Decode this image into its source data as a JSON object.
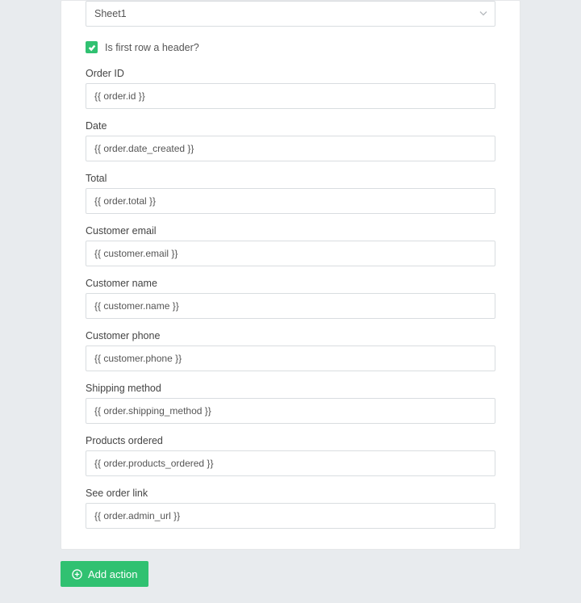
{
  "sheet": {
    "selected": "Sheet1"
  },
  "checkbox": {
    "label": "Is first row a header?",
    "checked": true
  },
  "fields": {
    "order_id": {
      "label": "Order ID",
      "value": "{{ order.id }}"
    },
    "date": {
      "label": "Date",
      "value": "{{ order.date_created }}"
    },
    "total": {
      "label": "Total",
      "value": "{{ order.total }}"
    },
    "customer_email": {
      "label": "Customer email",
      "value": "{{ customer.email }}"
    },
    "customer_name": {
      "label": "Customer name",
      "value": "{{ customer.name }}"
    },
    "customer_phone": {
      "label": "Customer phone",
      "value": "{{ customer.phone }}"
    },
    "shipping_method": {
      "label": "Shipping method",
      "value": "{{ order.shipping_method }}"
    },
    "products_ordered": {
      "label": "Products ordered",
      "value": "{{ order.products_ordered }}"
    },
    "see_order_link": {
      "label": "See order link",
      "value": "{{ order.admin_url }}"
    }
  },
  "actions": {
    "add_action_label": "Add action"
  },
  "colors": {
    "accent": "#30c171"
  }
}
